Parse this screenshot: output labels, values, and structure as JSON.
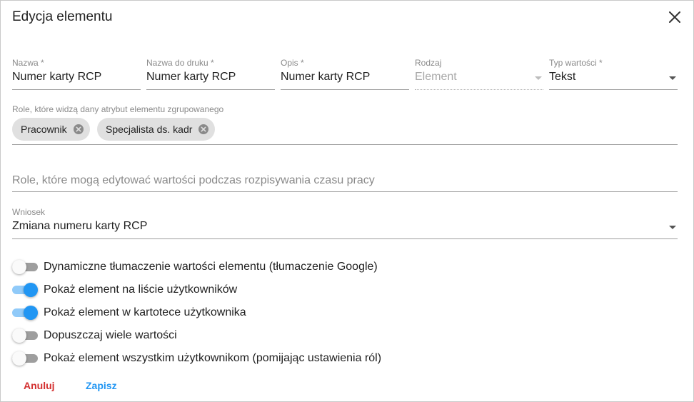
{
  "dialog": {
    "title": "Edycja elementu",
    "close_icon": "close-icon"
  },
  "fields": {
    "name": {
      "label": "Nazwa *",
      "value": "Numer karty RCP"
    },
    "print_name": {
      "label": "Nazwa do druku *",
      "value": "Numer karty RCP"
    },
    "description": {
      "label": "Opis *",
      "value": "Numer karty RCP"
    },
    "kind": {
      "label": "Rodzaj",
      "value": "Element",
      "disabled": true
    },
    "value_type": {
      "label": "Typ wartości *",
      "value": "Tekst"
    }
  },
  "view_roles": {
    "label": "Role, które widzą dany atrybut elementu zgrupowanego",
    "chips": [
      {
        "label": "Pracownik"
      },
      {
        "label": "Specjalista ds. kadr"
      }
    ]
  },
  "edit_roles": {
    "placeholder": "Role, które mogą edytować wartości podczas rozpisywania czasu pracy"
  },
  "request": {
    "label": "Wniosek",
    "value": "Zmiana numeru karty RCP"
  },
  "toggles": [
    {
      "label": "Dynamiczne tłumaczenie wartości elementu (tłumaczenie Google)",
      "on": false
    },
    {
      "label": "Pokaż element na liście użytkowników",
      "on": true
    },
    {
      "label": "Pokaż element w kartotece użytkownika",
      "on": true
    },
    {
      "label": "Dopuszczaj wiele wartości",
      "on": false
    },
    {
      "label": "Pokaż element wszystkim użytkownikom (pomijając ustawienia ról)",
      "on": false
    }
  ],
  "actions": {
    "cancel_label": "Anuluj",
    "save_label": "Zapisz"
  },
  "colors": {
    "accent": "#2196f3",
    "accent_track": "#90caf9",
    "cancel": "#d32f2f",
    "chip_bg": "#e0e0e0"
  }
}
